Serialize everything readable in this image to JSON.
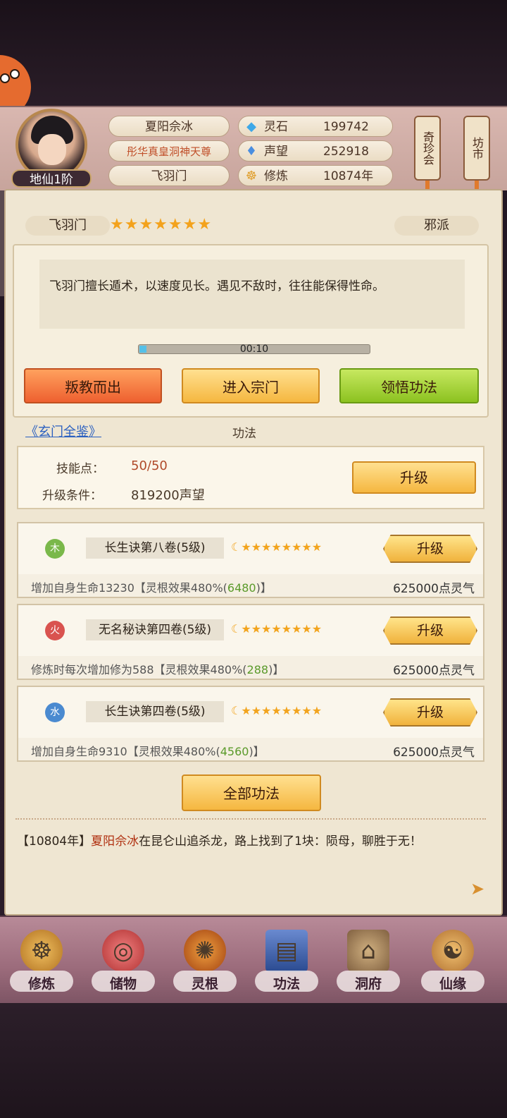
{
  "header": {
    "player_name": "夏阳佘冰",
    "title": "彤华真皇洞神天尊",
    "sect": "飞羽门",
    "rank": "地仙1阶",
    "stats": [
      {
        "label": "灵石",
        "value": "199742",
        "icon": "gem-icon"
      },
      {
        "label": "声望",
        "value": "252918",
        "icon": "crystal-icon"
      },
      {
        "label": "修炼",
        "value": "10874年",
        "icon": "meditation-icon"
      }
    ],
    "side_buttons": [
      {
        "label": "奇珍会"
      },
      {
        "label": "坊市"
      }
    ]
  },
  "sect_info": {
    "name": "飞羽门",
    "stars": "★★★★★★★",
    "type": "邪派",
    "description": "飞羽门擅长遁术，以速度见长。遇见不敌时，往往能保得性命。",
    "timer": "00:10",
    "timer_progress": 0.03,
    "buttons": {
      "betray": "叛教而出",
      "enter": "进入宗门",
      "comprehend": "领悟功法"
    }
  },
  "techniques": {
    "link": "《玄门全鉴》",
    "section_title": "功法",
    "skill_points_label": "技能点：",
    "skill_points_value": "50/50",
    "upgrade_cond_label": "升级条件：",
    "upgrade_cond_value": "819200声望",
    "upgrade_label": "升级",
    "items": [
      {
        "element": "木",
        "element_color": "#7ab84a",
        "name": "长生诀第八卷(5级)",
        "stars": "☾★★★★★★★★",
        "effect_pre": "增加自身生命13230【灵根效果480%(",
        "effect_green": "6480",
        "effect_post": ")】",
        "cost": "625000点灵气",
        "button": "升级"
      },
      {
        "element": "火",
        "element_color": "#d9534f",
        "name": "无名秘诀第四卷(5级)",
        "stars": "☾★★★★★★★★",
        "effect_pre": "修炼时每次增加修为588【灵根效果480%(",
        "effect_green": "288",
        "effect_post": ")】",
        "cost": "625000点灵气",
        "button": "升级"
      },
      {
        "element": "水",
        "element_color": "#4a8ad0",
        "name": "长生诀第四卷(5级)",
        "stars": "☾★★★★★★★★",
        "effect_pre": "增加自身生命9310【灵根效果480%(",
        "effect_green": "4560",
        "effect_post": ")】",
        "cost": "625000点灵气",
        "button": "升级"
      }
    ],
    "all_button": "全部功法"
  },
  "log": {
    "year": "【10804年】",
    "name": "夏阳佘冰",
    "text": "在昆仑山追杀龙，路上找到了1块：陨母，聊胜于无！"
  },
  "nav": [
    {
      "label": "修炼",
      "icon": "meditation-icon"
    },
    {
      "label": "储物",
      "icon": "bag-icon"
    },
    {
      "label": "灵根",
      "icon": "triskelion-icon"
    },
    {
      "label": "功法",
      "icon": "book-icon"
    },
    {
      "label": "洞府",
      "icon": "pavilion-icon"
    },
    {
      "label": "仙缘",
      "icon": "gourd-icon"
    }
  ]
}
